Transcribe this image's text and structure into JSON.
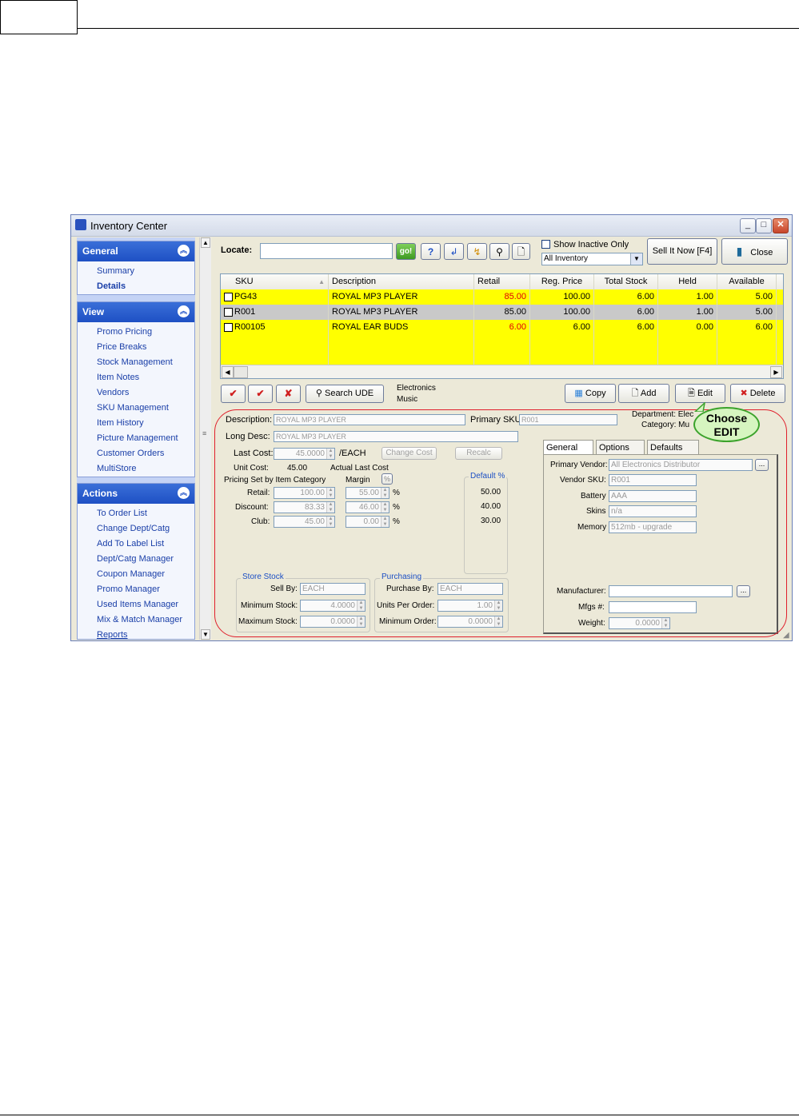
{
  "window": {
    "title": "Inventory Center"
  },
  "nav": {
    "general": {
      "header": "General",
      "items": [
        "Summary",
        "Details"
      ]
    },
    "view": {
      "header": "View",
      "items": [
        "Promo Pricing",
        "Price Breaks",
        "Stock Management",
        "Item Notes",
        "Vendors",
        "SKU Management",
        "Item History",
        "Picture Management",
        "Customer Orders",
        "MultiStore"
      ]
    },
    "actions": {
      "header": "Actions",
      "items": [
        "To Order List",
        "Change Dept/Catg",
        "Add To Label List",
        "Dept/Catg Manager",
        "Coupon Manager",
        "Promo Manager",
        "Used Items Manager",
        "Mix & Match Manager",
        "Reports"
      ]
    }
  },
  "toolbar": {
    "locate_label": "Locate:",
    "locate_value": "",
    "go_label": "go!",
    "show_inactive_label": "Show Inactive Only",
    "filter_value": "All Inventory",
    "sell_it_now_label": "Sell It Now [F4]",
    "close_label": "Close"
  },
  "grid": {
    "columns": [
      "SKU",
      "Description",
      "Retail",
      "Reg. Price",
      "Total Stock",
      "Held",
      "Available"
    ],
    "rows": [
      {
        "sku": "PG43",
        "description": "ROYAL MP3 PLAYER",
        "retail": "85.00",
        "reg_price": "100.00",
        "total_stock": "6.00",
        "held": "1.00",
        "available": "5.00"
      },
      {
        "sku": "R001",
        "description": "ROYAL MP3 PLAYER",
        "retail": "85.00",
        "reg_price": "100.00",
        "total_stock": "6.00",
        "held": "1.00",
        "available": "5.00"
      },
      {
        "sku": "R00105",
        "description": "ROYAL EAR BUDS",
        "retail": "6.00",
        "reg_price": "6.00",
        "total_stock": "6.00",
        "held": "0.00",
        "available": "6.00"
      }
    ],
    "retail_highlight_color": "#e00000",
    "row_highlight_color": "#ffff00"
  },
  "actionbar": {
    "search_ude_label": "Search UDE",
    "category_line1": "Electronics",
    "category_line2": "Music",
    "copy_label": "Copy",
    "add_label": "Add",
    "edit_label": "Edit",
    "delete_label": "Delete"
  },
  "details": {
    "description_label": "Description:",
    "description_value": "ROYAL MP3 PLAYER",
    "primary_sku_label": "Primary SKU:",
    "primary_sku_value": "R001",
    "department_text": "Department: Elec",
    "category_text": "Category: Mu",
    "long_desc_label": "Long Desc:",
    "long_desc_value": "ROYAL MP3 PLAYER",
    "last_cost_label": "Last Cost:",
    "last_cost_value": "45.0000",
    "per_unit": "/EACH",
    "change_cost_label": "Change Cost",
    "recalc_label": "Recalc",
    "unit_cost_label": "Unit Cost:",
    "unit_cost_value": "45.00",
    "actual_last_cost_label": "Actual Last Cost",
    "pricing_set_label": "Pricing Set by Item Category",
    "margin_label": "Margin",
    "pct_button": "%",
    "default_pct_label": "Default %",
    "price_rows": [
      {
        "label": "Retail:",
        "value": "100.00",
        "margin": "55.00",
        "default": "50.00"
      },
      {
        "label": "Discount:",
        "value": "83.33",
        "margin": "46.00",
        "default": "40.00"
      },
      {
        "label": "Club:",
        "value": "45.00",
        "margin": "0.00",
        "default": "30.00"
      }
    ],
    "store_stock": {
      "title": "Store Stock",
      "sell_by_label": "Sell By:",
      "sell_by_value": "EACH",
      "min_label": "Minimum Stock:",
      "min_value": "4.0000",
      "max_label": "Maximum Stock:",
      "max_value": "0.0000"
    },
    "purchasing": {
      "title": "Purchasing",
      "purchase_by_label": "Purchase By:",
      "purchase_by_value": "EACH",
      "units_label": "Units Per Order:",
      "units_value": "1.00",
      "min_order_label": "Minimum Order:",
      "min_order_value": "0.0000"
    },
    "tabs": [
      "General [F7]",
      "Options [F8]",
      "Defaults [F9]"
    ],
    "general_tab": {
      "primary_vendor_label": "Primary Vendor:",
      "primary_vendor_value": "All Electronics Distributor",
      "vendor_sku_label": "Vendor SKU:",
      "vendor_sku_value": "R001",
      "battery_label": "Battery",
      "battery_value": "AAA",
      "skins_label": "Skins",
      "skins_value": "n/a",
      "memory_label": "Memory",
      "memory_value": "512mb - upgrade",
      "manufacturer_label": "Manufacturer:",
      "manufacturer_value": "",
      "mfgs_label": "Mfgs #:",
      "mfgs_value": "",
      "weight_label": "Weight:",
      "weight_value": "0.0000"
    }
  },
  "callout": {
    "line1": "Choose",
    "line2": "EDIT"
  },
  "colors": {
    "nav_header": "#1e50c4",
    "annotation_red": "#e0202c",
    "callout_fill": "#d6f5c0"
  }
}
